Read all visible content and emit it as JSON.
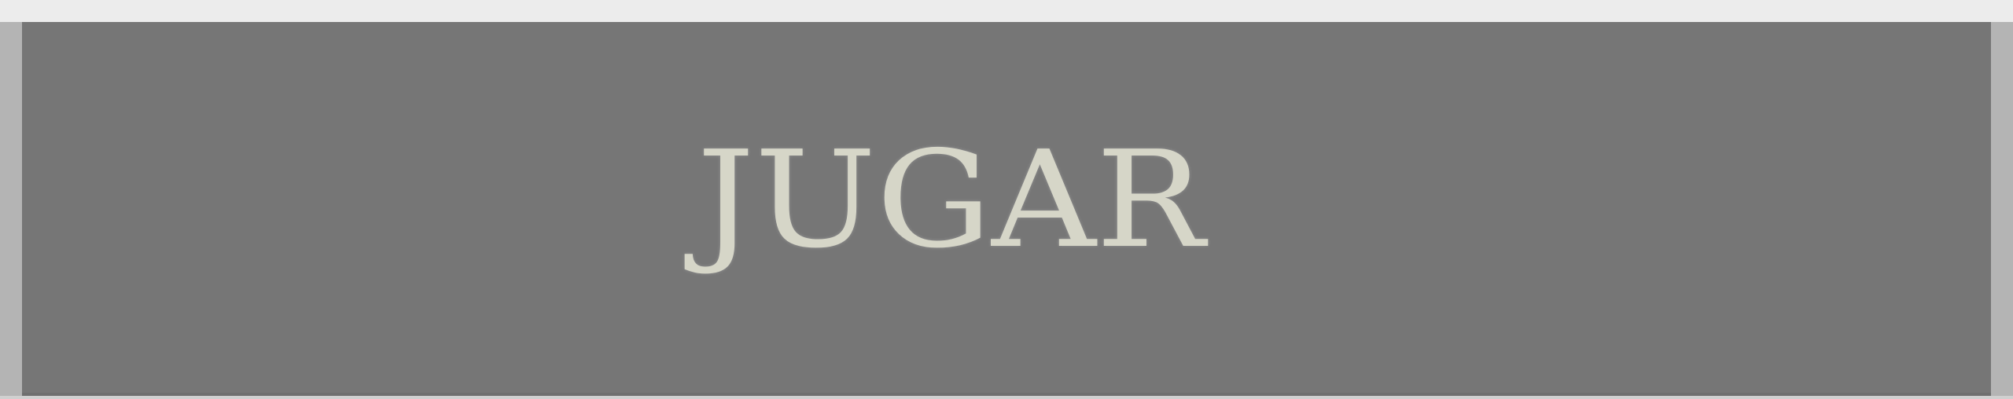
{
  "button": {
    "label": "JUGAR"
  },
  "colors": {
    "page_background": "#ececec",
    "button_background": "#767676",
    "side_edges": "#b4b4b4",
    "label_color": "#d6d6c8"
  }
}
